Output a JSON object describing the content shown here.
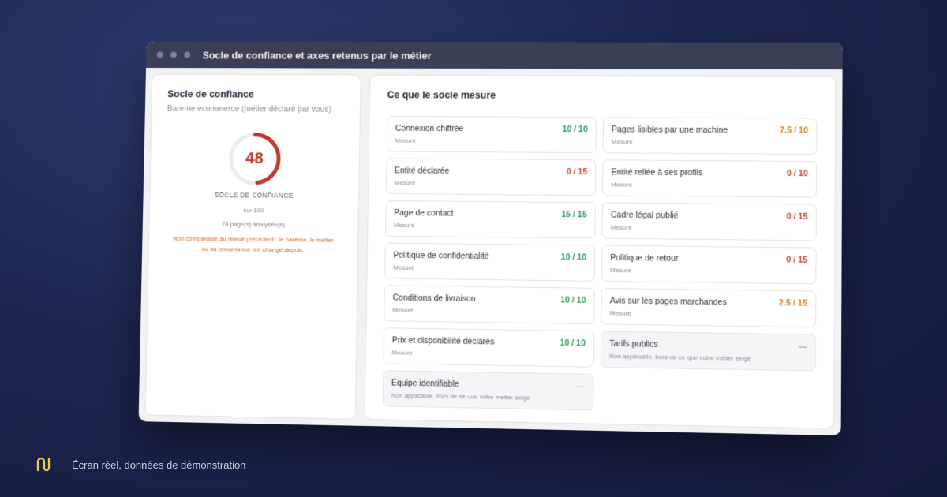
{
  "window": {
    "title": "Socle de confiance et axes retenus par le métier"
  },
  "left": {
    "title": "Socle de confiance",
    "subtitle": "Barème ecommerce (métier déclaré par vous)",
    "score": "48",
    "score_fraction": 0.48,
    "score_label": "SOCLE DE CONFIANCE",
    "score_max": "sur 100",
    "pages": "24 page(s) analysée(s)",
    "warning": "Non comparable au relevé précédent : le barème, le métier ou sa provenance ont changé depuis."
  },
  "right": {
    "title": "Ce que le socle mesure",
    "cards": [
      {
        "label": "Connexion chiffrée",
        "status": "Mesuré",
        "value": "10 / 10",
        "color": "green"
      },
      {
        "label": "Pages lisibles par une machine",
        "status": "Mesuré",
        "value": "7.5 / 10",
        "color": "orange"
      },
      {
        "label": "Entité déclarée",
        "status": "Mesuré",
        "value": "0 / 15",
        "color": "red"
      },
      {
        "label": "Entité reliée à ses profils",
        "status": "Mesuré",
        "value": "0 / 10",
        "color": "red"
      },
      {
        "label": "Page de contact",
        "status": "Mesuré",
        "value": "15 / 15",
        "color": "green"
      },
      {
        "label": "Cadre légal publié",
        "status": "Mesuré",
        "value": "0 / 15",
        "color": "red"
      },
      {
        "label": "Politique de confidentialité",
        "status": "Mesuré",
        "value": "10 / 10",
        "color": "green"
      },
      {
        "label": "Politique de retour",
        "status": "Mesuré",
        "value": "0 / 15",
        "color": "red"
      },
      {
        "label": "Conditions de livraison",
        "status": "Mesuré",
        "value": "10 / 10",
        "color": "green"
      },
      {
        "label": "Avis sur les pages marchandes",
        "status": "Mesuré",
        "value": "2.5 / 15",
        "color": "orange"
      },
      {
        "label": "Prix et disponibilité déclarés",
        "status": "Mesuré",
        "value": "10 / 10",
        "color": "green"
      },
      {
        "label": "Tarifs publics",
        "status": "Non applicable, hors de ce que votre métier exige",
        "value": "—",
        "color": "dash",
        "na": true
      },
      {
        "label": "Équipe identifiable",
        "status": "Non applicable, hors de ce que votre métier exige",
        "value": "—",
        "color": "dash",
        "na": true
      }
    ]
  },
  "footer": {
    "text": "Écran réel, données de démonstration"
  },
  "colors": {
    "green": "#2e9a5a",
    "red": "#d0412f",
    "orange": "#d97d1c",
    "gauge": "#c0392b",
    "logo": "#e8c94a"
  }
}
